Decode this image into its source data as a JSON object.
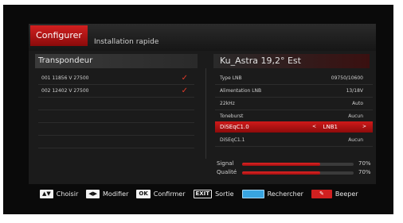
{
  "header": {
    "tab_label": "Configurer",
    "subtitle": "Installation rapide"
  },
  "left_panel": {
    "title": "Transpondeur",
    "rows": [
      {
        "label": "001 11856 V 27500",
        "checked": true
      },
      {
        "label": "002 12402 V 27500",
        "checked": true
      }
    ]
  },
  "right_panel": {
    "satellite": "Ku_Astra 19,2° Est",
    "rows": [
      {
        "key": "Type LNB",
        "value": "09750/10600"
      },
      {
        "key": "Alimentation LNB",
        "value": "13/18V"
      },
      {
        "key": "22kHz",
        "value": "Auto"
      },
      {
        "key": "Toneburst",
        "value": "Aucun"
      },
      {
        "key": "DiSEqC1.0",
        "value": "LNB1",
        "selected": true
      },
      {
        "key": "DiSEqC1.1",
        "value": "Aucun"
      }
    ]
  },
  "meters": {
    "signal": {
      "label": "Signal",
      "percent_text": "70%",
      "fraction": 0.7
    },
    "quality": {
      "label": "Qualité",
      "percent_text": "70%",
      "fraction": 0.7
    }
  },
  "footer": {
    "choose": "Choisir",
    "modify": "Modifier",
    "confirm": "Confirmer",
    "exit": "Sortie",
    "search": "Rechercher",
    "beeper": "Beeper",
    "ok_key": "OK",
    "exit_key": "EXIT"
  },
  "colors": {
    "accent": "#d01a1a",
    "background": "#0a0a0a",
    "search_key": "#38a4e0"
  },
  "icons": {
    "check": "check-icon",
    "arrow_left": "chevron-left-icon",
    "arrow_right": "chevron-right-icon"
  }
}
